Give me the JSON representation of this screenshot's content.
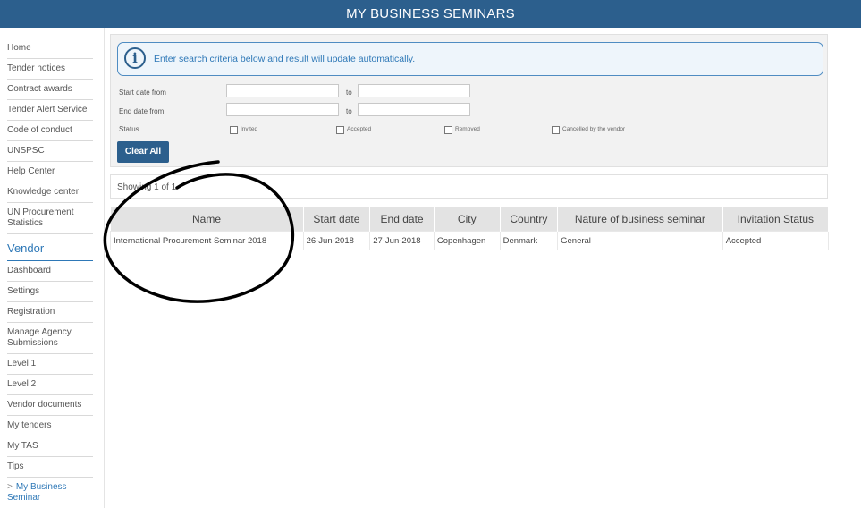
{
  "header": {
    "title": "MY BUSINESS SEMINARS"
  },
  "sidebar": {
    "items": [
      "Home",
      "Tender notices",
      "Contract awards",
      "Tender Alert Service",
      "Code of conduct",
      "UNSPSC",
      "Help Center",
      "Knowledge center",
      "UN Procurement Statistics"
    ],
    "vendor_heading": "Vendor",
    "vendor_items": [
      "Dashboard",
      "Settings",
      "Registration",
      "Manage Agency Submissions",
      "Level 1",
      "Level 2",
      "Vendor documents",
      "My tenders",
      "My TAS",
      "Tips"
    ],
    "active_item": {
      "chevron": ">",
      "label": "My Business Seminar"
    }
  },
  "filters": {
    "info_text": "Enter search criteria below and result will update automatically.",
    "start_date_label": "Start date from",
    "end_date_label": "End date from",
    "to_label": "to",
    "status_label": "Status",
    "status_options": [
      "Invited",
      "Accepted",
      "Removed",
      "Cancelled by the vendor"
    ],
    "clear_button": "Clear All"
  },
  "results": {
    "showing": "Showing 1 of 1",
    "columns": [
      "Name",
      "Start date",
      "End date",
      "City",
      "Country",
      "Nature of business seminar",
      "Invitation Status"
    ],
    "rows": [
      [
        "International Procurement Seminar 2018",
        "26-Jun-2018",
        "27-Jun-2018",
        "Copenhagen",
        "Denmark",
        "General",
        "Accepted"
      ]
    ]
  },
  "colors": {
    "header_bg": "#2c5f8d",
    "accent": "#2e78b7",
    "table_header_bg": "#e3e3e3"
  }
}
